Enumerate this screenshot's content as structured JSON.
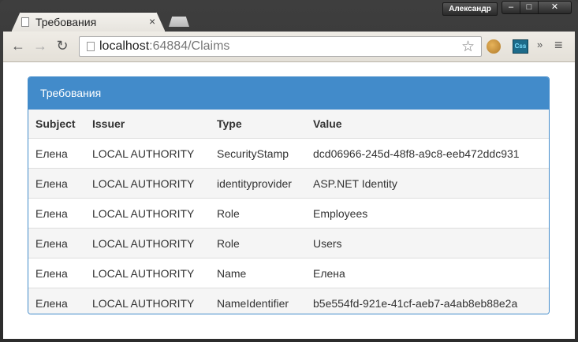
{
  "window": {
    "user": "Александр",
    "buttons": {
      "minimize": "–",
      "maximize": "□",
      "close": "✕"
    }
  },
  "tab": {
    "title": "Требования",
    "close": "×"
  },
  "toolbar": {
    "url_host": "localhost",
    "url_rest": ":64884/Claims",
    "back_icon": "←",
    "forward_icon": "→",
    "reload_icon": "↻",
    "star_icon": "☆",
    "more_icon": "»",
    "menu_icon": "≡",
    "css_ext_label": "Css"
  },
  "panel": {
    "title": "Требования",
    "accent_color": "#428bca",
    "columns": [
      "Subject",
      "Issuer",
      "Type",
      "Value"
    ],
    "rows": [
      [
        "Елена",
        "LOCAL AUTHORITY",
        "SecurityStamp",
        "dcd06966-245d-48f8-a9c8-eeb472ddc931"
      ],
      [
        "Елена",
        "LOCAL AUTHORITY",
        "identityprovider",
        "ASP.NET Identity"
      ],
      [
        "Елена",
        "LOCAL AUTHORITY",
        "Role",
        "Employees"
      ],
      [
        "Елена",
        "LOCAL AUTHORITY",
        "Role",
        "Users"
      ],
      [
        "Елена",
        "LOCAL AUTHORITY",
        "Name",
        "Елена"
      ],
      [
        "Елена",
        "LOCAL AUTHORITY",
        "NameIdentifier",
        "b5e554fd-921e-41cf-aeb7-a4ab8eb88e2a"
      ]
    ]
  }
}
